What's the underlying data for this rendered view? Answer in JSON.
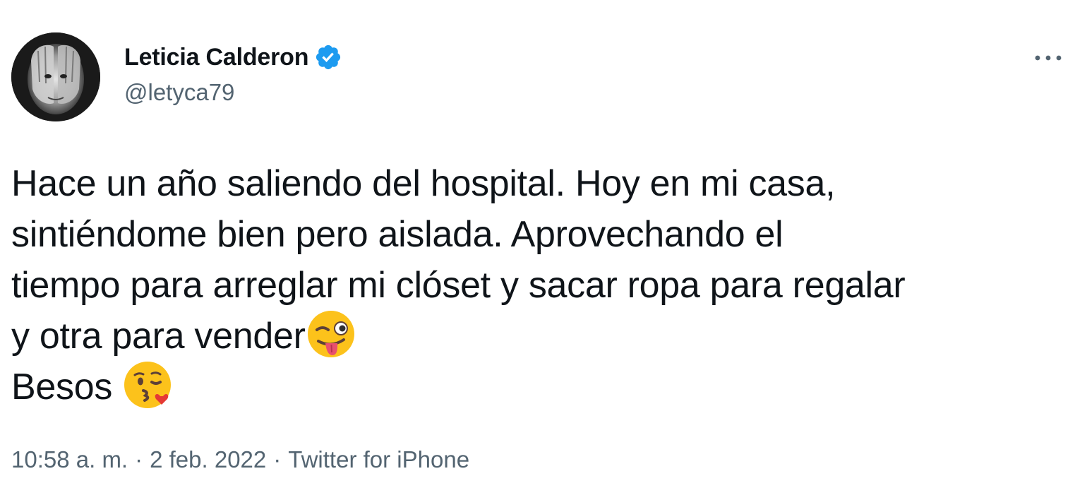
{
  "author": {
    "name": "Leticia Calderon",
    "handle": "@letyca79",
    "verified": true
  },
  "tweet": {
    "lines": [
      "Hace un año saliendo del hospital. Hoy en mi casa,",
      "sintiéndome bien pero aislada. Aprovechando el",
      "tiempo para arreglar mi clóset y sacar ropa para regalar",
      "y otra para vender",
      "Besos "
    ],
    "emojis": [
      "winking-face-with-tongue",
      "face-blowing-a-kiss"
    ]
  },
  "meta": {
    "time": "10:58 a. m.",
    "separator": "·",
    "date": "2 feb. 2022",
    "source": "Twitter for iPhone"
  },
  "icons": {
    "verified_badge": "verified-badge-icon",
    "more": "more-options-icon"
  },
  "colors": {
    "text_primary": "#0f1419",
    "text_secondary": "#536471",
    "verified_blue": "#1d9bf0",
    "background": "#ffffff"
  }
}
